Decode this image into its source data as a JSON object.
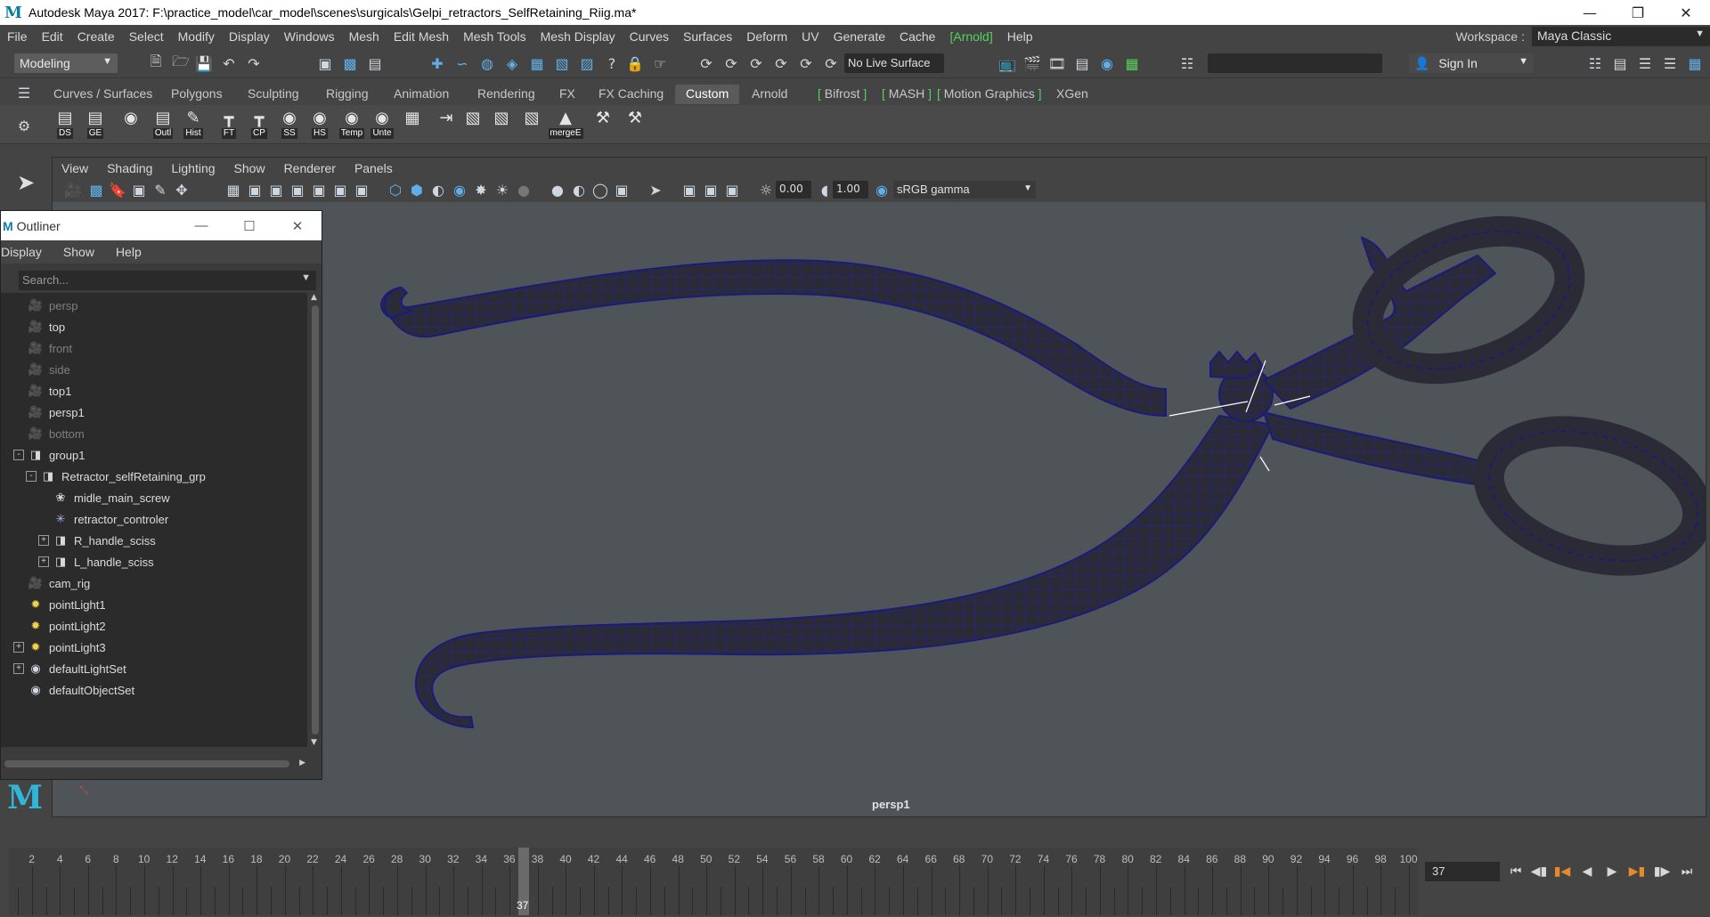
{
  "window": {
    "title": "Autodesk Maya 2017: F:\\practice_model\\car_model\\scenes\\surgicals\\Gelpi_retractors_SelfRetaining_Riig.ma*",
    "minimize": "—",
    "restore": "❐",
    "close": "✕"
  },
  "menubar": {
    "items": [
      "File",
      "Edit",
      "Create",
      "Select",
      "Modify",
      "Display",
      "Windows",
      "Mesh",
      "Edit Mesh",
      "Mesh Tools",
      "Mesh Display",
      "Curves",
      "Surfaces",
      "Deform",
      "UV",
      "Generate",
      "Cache",
      "[Arnold]",
      "Help"
    ],
    "workspace_label": "Workspace :",
    "workspace_value": "Maya Classic"
  },
  "statusline": {
    "mode": "Modeling",
    "live_surface": "No Live Surface",
    "sign_in": "Sign In"
  },
  "shelf": {
    "tabs": [
      "Curves / Surfaces",
      "Polygons",
      "Sculpting",
      "Rigging",
      "Animation",
      "Rendering",
      "FX",
      "FX Caching",
      "Custom",
      "Arnold",
      "Bifrost",
      "MASH",
      "Motion Graphics",
      "XGen"
    ],
    "active_tab": "Custom",
    "icons": [
      {
        "label": "DS",
        "icon": "window-icon"
      },
      {
        "label": "GE",
        "icon": "window-icon"
      },
      {
        "label": "",
        "icon": "circle-icon"
      },
      {
        "label": "Outl",
        "icon": "window-icon"
      },
      {
        "label": "Hist",
        "icon": "pencil-icon"
      },
      {
        "label": "FT",
        "icon": "axis-icon"
      },
      {
        "label": "CP",
        "icon": "axis-icon"
      },
      {
        "label": "SS",
        "icon": "eye-icon"
      },
      {
        "label": "HS",
        "icon": "eye-icon"
      },
      {
        "label": "Temp",
        "icon": "eye-icon"
      },
      {
        "label": "Unte",
        "icon": "eye-icon"
      },
      {
        "label": "",
        "icon": "checker-icon"
      },
      {
        "label": "",
        "icon": "export-icon"
      },
      {
        "label": "",
        "icon": "cube-icon"
      },
      {
        "label": "",
        "icon": "cube-icon"
      },
      {
        "label": "",
        "icon": "cube-icon"
      },
      {
        "label": "mergeE",
        "icon": "merge-icon"
      },
      {
        "label": "",
        "icon": "tool-icon"
      },
      {
        "label": "",
        "icon": "tool-icon"
      }
    ]
  },
  "viewport": {
    "menu": [
      "View",
      "Shading",
      "Lighting",
      "Show",
      "Renderer",
      "Panels"
    ],
    "exposure": "0.00",
    "gamma": "1.00",
    "color_space": "sRGB gamma",
    "camera_label": "persp1"
  },
  "outliner": {
    "title": "Outliner",
    "menu": [
      "Display",
      "Show",
      "Help"
    ],
    "search_placeholder": "Search...",
    "rows": [
      {
        "label": "persp",
        "icon": "camera-icon",
        "depth": 0,
        "expander": "",
        "dim": true
      },
      {
        "label": "top",
        "icon": "camera-icon",
        "depth": 0,
        "expander": "",
        "dim": false
      },
      {
        "label": "front",
        "icon": "camera-icon",
        "depth": 0,
        "expander": "",
        "dim": true
      },
      {
        "label": "side",
        "icon": "camera-icon",
        "depth": 0,
        "expander": "",
        "dim": true
      },
      {
        "label": "top1",
        "icon": "camera-icon",
        "depth": 0,
        "expander": "",
        "dim": false
      },
      {
        "label": "persp1",
        "icon": "camera-icon",
        "depth": 0,
        "expander": "",
        "dim": false
      },
      {
        "label": "bottom",
        "icon": "camera-icon",
        "depth": 0,
        "expander": "",
        "dim": true
      },
      {
        "label": "group1",
        "icon": "group-icon",
        "depth": 0,
        "expander": "-",
        "dim": false
      },
      {
        "label": "Retractor_selfRetaining_grp",
        "icon": "group-icon",
        "depth": 1,
        "expander": "-",
        "dim": false
      },
      {
        "label": "midle_main_screw",
        "icon": "mesh-icon",
        "depth": 2,
        "expander": "",
        "dim": false
      },
      {
        "label": "retractor_controler",
        "icon": "locator-icon",
        "depth": 2,
        "expander": "",
        "dim": false
      },
      {
        "label": "R_handle_sciss",
        "icon": "group-icon",
        "depth": 2,
        "expander": "+",
        "dim": false
      },
      {
        "label": "L_handle_sciss",
        "icon": "group-icon",
        "depth": 2,
        "expander": "+",
        "dim": false
      },
      {
        "label": "cam_rig",
        "icon": "camera-icon",
        "depth": 0,
        "expander": "",
        "dim": false
      },
      {
        "label": "pointLight1",
        "icon": "light-icon",
        "depth": 0,
        "expander": "",
        "dim": false
      },
      {
        "label": "pointLight2",
        "icon": "light-icon",
        "depth": 0,
        "expander": "",
        "dim": false
      },
      {
        "label": "pointLight3",
        "icon": "light-icon",
        "depth": 0,
        "expander": "+",
        "dim": false
      },
      {
        "label": "defaultLightSet",
        "icon": "set-icon",
        "depth": 0,
        "expander": "+",
        "dim": false
      },
      {
        "label": "defaultObjectSet",
        "icon": "set-icon",
        "depth": 0,
        "expander": "",
        "dim": false
      }
    ]
  },
  "timeline": {
    "ticks": [
      "2",
      "4",
      "6",
      "8",
      "10",
      "12",
      "14",
      "16",
      "18",
      "20",
      "22",
      "24",
      "26",
      "28",
      "30",
      "32",
      "34",
      "36",
      "38",
      "40",
      "42",
      "44",
      "46",
      "48",
      "50",
      "52",
      "54",
      "56",
      "58",
      "60",
      "62",
      "64",
      "66",
      "68",
      "70",
      "72",
      "74",
      "76",
      "78",
      "80",
      "82",
      "84",
      "86",
      "88",
      "90",
      "92",
      "94",
      "96",
      "98",
      "100"
    ],
    "current_frame": "37",
    "frame_field": "37",
    "range_start": 1,
    "range_end": 100
  },
  "colors": {
    "viewport_bg": "#4f5459",
    "mesh_fill": "#2a2a38",
    "wire": "#1d1d9a",
    "arnold_green": "#53d35a"
  }
}
